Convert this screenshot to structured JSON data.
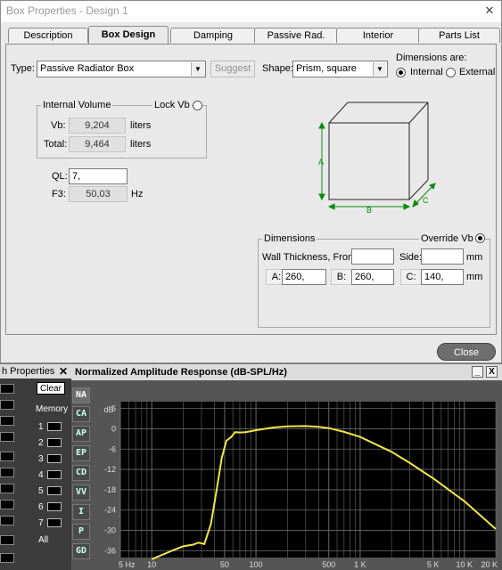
{
  "window": {
    "title": "Box Properties - Design 1",
    "close_glyph": "✕"
  },
  "tabs": [
    {
      "label": "Description",
      "active": false
    },
    {
      "label": "Box Design",
      "active": true
    },
    {
      "label": "Damping",
      "active": false
    },
    {
      "label": "Passive Rad.",
      "active": false
    },
    {
      "label": "Interior",
      "active": false
    },
    {
      "label": "Parts List",
      "active": false
    }
  ],
  "design": {
    "type_label": "Type:",
    "type_value": "Passive Radiator Box",
    "suggest_label": "Suggest",
    "shape_label": "Shape:",
    "shape_value": "Prism, square",
    "dims_are_label": "Dimensions are:",
    "internal_label": "Internal",
    "external_label": "External",
    "internal_selected": true
  },
  "volume": {
    "group_label": "Internal Volume",
    "lock_label": "Lock Vb",
    "vb_label": "Vb:",
    "vb_value": "9,204",
    "vb_unit": "liters",
    "total_label": "Total:",
    "total_value": "9,464",
    "total_unit": "liters"
  },
  "params": {
    "ql_label": "QL:",
    "ql_value": "7,",
    "f3_label": "F3:",
    "f3_value": "50,03",
    "f3_unit": "Hz"
  },
  "diagram": {
    "label_a": "A",
    "label_b": "B",
    "label_c": "C"
  },
  "dimensions": {
    "group_label": "Dimensions",
    "override_label": "Override Vb",
    "wall_label": "Wall Thickness, Front:",
    "wall_value": "",
    "side_label": "Side:",
    "side_value": "",
    "side_unit": "mm",
    "a_label": "A:",
    "a_value": "260,",
    "b_label": "B:",
    "b_value": "260,",
    "c_label": "C:",
    "c_value": "140,",
    "unit": "mm"
  },
  "close_label": "Close",
  "left_panel": {
    "title": "h Properties",
    "close_glyph": "✕",
    "clear_label": "Clear",
    "memory_label": "Memory",
    "slots": [
      "1",
      "2",
      "3",
      "4",
      "5",
      "6",
      "7"
    ],
    "all_label": "All"
  },
  "graph": {
    "title": "Normalized Amplitude Response (dB-SPL/Hz)",
    "min_glyph": "_",
    "close_glyph": "X",
    "side_buttons": [
      "NA",
      "CA",
      "AP",
      "EP",
      "CD",
      "VV",
      "I",
      "P",
      "GD"
    ],
    "colors": {
      "trace": "#f0e64a",
      "grid": "#6a6a6a",
      "background": "#000000"
    }
  },
  "chart_data": {
    "type": "line",
    "title": "Normalized Amplitude Response (dB-SPL/Hz)",
    "ylabel": "dB",
    "x_scale": "log",
    "xlim": [
      5,
      20000
    ],
    "ylim": [
      -38,
      8
    ],
    "y_ticks": [
      6,
      0,
      -6,
      -12,
      -18,
      -24,
      -30,
      -36
    ],
    "y_tick_labels": [
      "6",
      "0",
      "-6",
      "-12",
      "-18",
      "-24",
      "-30",
      "-36"
    ],
    "x_ticks": [
      5,
      10,
      50,
      100,
      500,
      1000,
      5000,
      10000,
      20000
    ],
    "x_tick_labels": [
      "5 Hz",
      "10",
      "50",
      "100",
      "500",
      "1 K",
      "5 K",
      "10 K",
      "20 K"
    ],
    "grid": true,
    "series": [
      {
        "x": [
          10,
          15,
          20,
          25,
          28,
          32,
          37,
          42,
          47,
          52,
          58,
          63,
          70,
          80,
          100,
          150,
          200,
          300,
          400,
          500,
          700,
          1000,
          2000,
          3000,
          5000,
          10000,
          20000
        ],
        "y": [
          -38.5,
          -36.2,
          -34.7,
          -34.2,
          -33.6,
          -34.0,
          -28.0,
          -18.0,
          -8.6,
          -3.5,
          -2.4,
          -1.0,
          -1.1,
          -1.0,
          -0.4,
          0.4,
          0.7,
          0.8,
          0.6,
          0.2,
          -0.9,
          -2.4,
          -6.8,
          -10.1,
          -14.6,
          -21.4,
          -29.6
        ]
      }
    ]
  }
}
